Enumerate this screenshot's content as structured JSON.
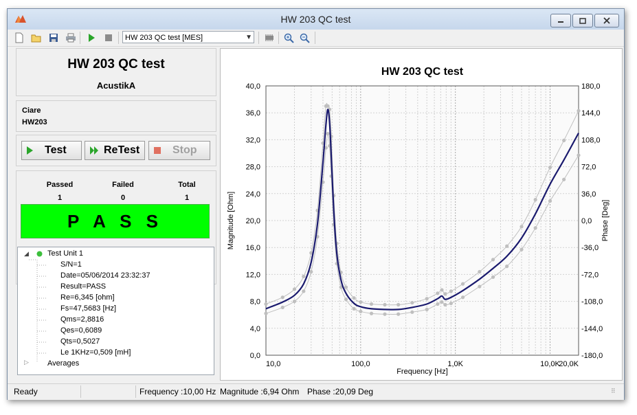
{
  "window": {
    "title": "HW 203 QC test"
  },
  "toolbar": {
    "profile_select": "HW 203 QC test [MES]"
  },
  "header": {
    "title": "HW 203 QC test",
    "company": "AcustikA"
  },
  "info": {
    "line1": "Ciare",
    "line2": "HW203"
  },
  "buttons": {
    "test": "Test",
    "retest": "ReTest",
    "stop": "Stop"
  },
  "stats": {
    "passed_label": "Passed",
    "failed_label": "Failed",
    "total_label": "Total",
    "passed": "1",
    "failed": "0",
    "total": "1"
  },
  "result": {
    "text": "P A S S",
    "color": "#00ff00"
  },
  "tree": {
    "root": "Test Unit 1",
    "items": [
      "S/N=1",
      "Date=05/06/2014 23:32:37",
      "Result=PASS",
      "Re=6,345 [ohm]",
      "Fs=47,5683 [Hz]",
      "Qms=2,8816",
      "Qes=0,6089",
      "Qts=0,5027",
      "Le 1KHz=0,509 [mH]"
    ],
    "averages": "Averages"
  },
  "status": {
    "ready": "Ready",
    "frequency": "Frequency :10,00 Hz",
    "magnitude": "Magnitude :6,94 Ohm",
    "phase": "Phase :20,09 Deg"
  },
  "chart_data": {
    "type": "line",
    "title": "HW 203 QC test",
    "xlabel": "Frequency  [Hz]",
    "ylabel": "Magnitude  [Ohm]",
    "y2label": "Phase  [Deg]",
    "x_scale": "log",
    "xlim": [
      10,
      20000
    ],
    "ylim": [
      0,
      40
    ],
    "y2lim": [
      -180,
      180
    ],
    "x_ticks": [
      "10,0",
      "100,0",
      "1,0K",
      "10,0K",
      "20,0K"
    ],
    "y_ticks": [
      "0,0",
      "4,0",
      "8,0",
      "12,0",
      "16,0",
      "20,0",
      "24,0",
      "28,0",
      "32,0",
      "36,0",
      "40,0"
    ],
    "y2_ticks": [
      "-180,0",
      "-144,0",
      "-108,0",
      "-72,0",
      "-36,0",
      "0,0",
      "36,0",
      "72,0",
      "108,0",
      "144,0",
      "180,0"
    ],
    "grid": true,
    "colors": {
      "measured": "#1a1a6e",
      "limits": "#bfbfbf"
    },
    "series": [
      {
        "role": "measured",
        "x": [
          10,
          15,
          20,
          25,
          30,
          35,
          40,
          43,
          45,
          47,
          49,
          52,
          56,
          62,
          70,
          85,
          100,
          130,
          180,
          250,
          350,
          500,
          650,
          720,
          780,
          900,
          1200,
          1800,
          2500,
          3500,
          5000,
          7000,
          10000,
          14000,
          20000
        ],
        "y": [
          6.9,
          7.9,
          8.9,
          10.6,
          13.8,
          19.5,
          28.6,
          34.2,
          36.5,
          34.6,
          29.5,
          21.5,
          15.1,
          11.2,
          9.2,
          7.7,
          7.2,
          6.9,
          6.8,
          6.8,
          7.1,
          7.6,
          8.4,
          8.8,
          8.3,
          8.6,
          9.6,
          11.3,
          12.9,
          14.7,
          17.4,
          21.0,
          25.4,
          29.0,
          33.0
        ]
      },
      {
        "role": "upper-limit",
        "x": [
          10,
          15,
          20,
          25,
          30,
          35,
          40,
          43,
          45,
          47,
          49,
          52,
          56,
          62,
          70,
          85,
          100,
          130,
          180,
          250,
          350,
          500,
          650,
          720,
          780,
          900,
          1200,
          1800,
          2500,
          3500,
          5000,
          7000,
          10000,
          14000,
          20000
        ],
        "y": [
          7.6,
          8.6,
          9.8,
          11.7,
          15.2,
          21.5,
          31.5,
          37.0,
          37.0,
          36.5,
          32.5,
          23.7,
          16.6,
          12.3,
          10.1,
          8.5,
          7.9,
          7.6,
          7.5,
          7.5,
          7.8,
          8.4,
          9.2,
          9.7,
          9.1,
          9.5,
          10.6,
          12.4,
          14.2,
          16.2,
          19.1,
          23.1,
          27.9,
          31.9,
          36.3
        ]
      },
      {
        "role": "lower-limit",
        "x": [
          10,
          15,
          20,
          25,
          30,
          35,
          40,
          43,
          45,
          47,
          49,
          52,
          56,
          62,
          70,
          85,
          100,
          130,
          180,
          250,
          350,
          500,
          650,
          720,
          780,
          900,
          1200,
          1800,
          2500,
          3500,
          5000,
          7000,
          10000,
          14000,
          20000
        ],
        "y": [
          6.2,
          7.1,
          8.0,
          9.5,
          12.4,
          17.6,
          25.7,
          30.8,
          32.9,
          31.1,
          26.6,
          19.4,
          13.6,
          10.1,
          8.3,
          6.9,
          6.5,
          6.2,
          6.1,
          6.1,
          6.4,
          6.8,
          7.6,
          7.9,
          7.5,
          7.7,
          8.6,
          10.2,
          11.6,
          13.2,
          15.7,
          18.9,
          22.9,
          26.1,
          29.7
        ]
      }
    ]
  }
}
